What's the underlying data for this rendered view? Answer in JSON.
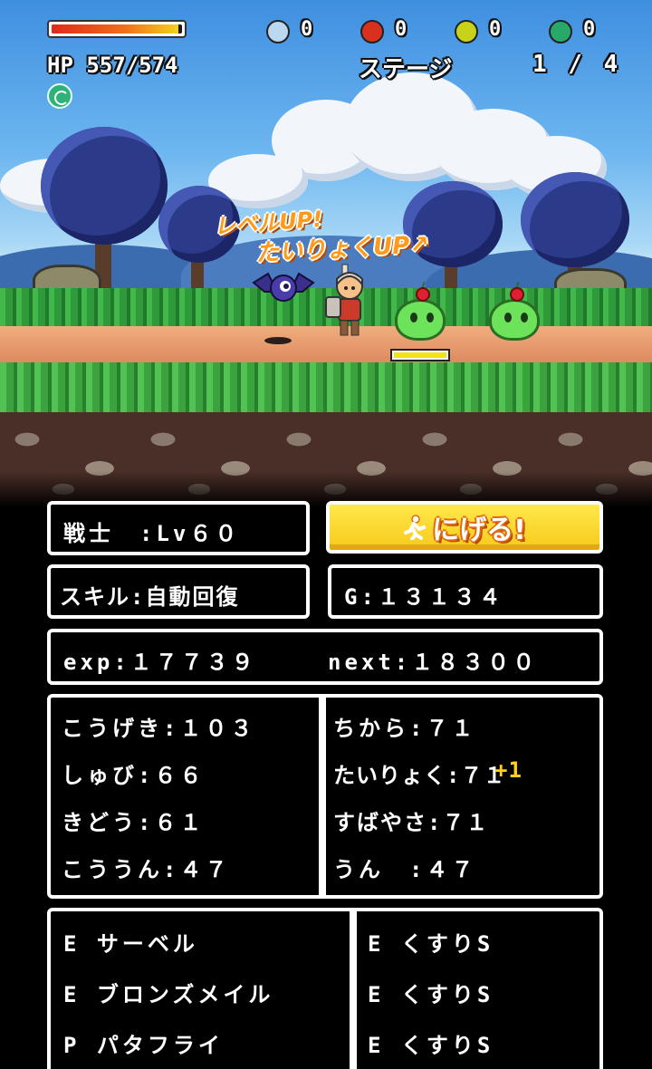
{
  "hud": {
    "hp_label": "HP 557/574",
    "hp_fraction": 0.97,
    "stage_label": "ステージ",
    "stage_value": "1 / 4",
    "items": [
      {
        "icon": "blue-egg-icon",
        "color": "#bcd8ef",
        "count": "0"
      },
      {
        "icon": "red-sword-orb-icon",
        "color": "#d8321e",
        "count": "0"
      },
      {
        "icon": "yellow-shield-orb-icon",
        "color": "#c8d21a",
        "count": "0"
      },
      {
        "icon": "green-potion-orb-icon",
        "color": "#2aa86a",
        "count": "0"
      }
    ]
  },
  "battle": {
    "popup_level": "レベルUP!",
    "popup_stat": "たいりょくUP↗",
    "enemy_hp_fraction": 1.0
  },
  "status": {
    "job_level": "戦士　:Lv６０",
    "flee_button": "にげる!",
    "skill": "スキル:自動回復",
    "gold": "G:１３１３４",
    "exp": "exp:１７７３９",
    "next": "next:１８３００"
  },
  "stats": {
    "left": [
      "こうげき:１０３",
      "しゅび:６６",
      "きどう:６１",
      "こううん:４７"
    ],
    "right": [
      "ちから:７１",
      "たいりょく:７１",
      "すばやさ:７１",
      "うん　:４７"
    ],
    "bonus": "+1"
  },
  "equipment": {
    "left": [
      "E サーベル",
      "E ブロンズメイル",
      "P パタフライ"
    ],
    "right": [
      "E くすりS",
      "E くすりS",
      "E くすりS"
    ]
  }
}
